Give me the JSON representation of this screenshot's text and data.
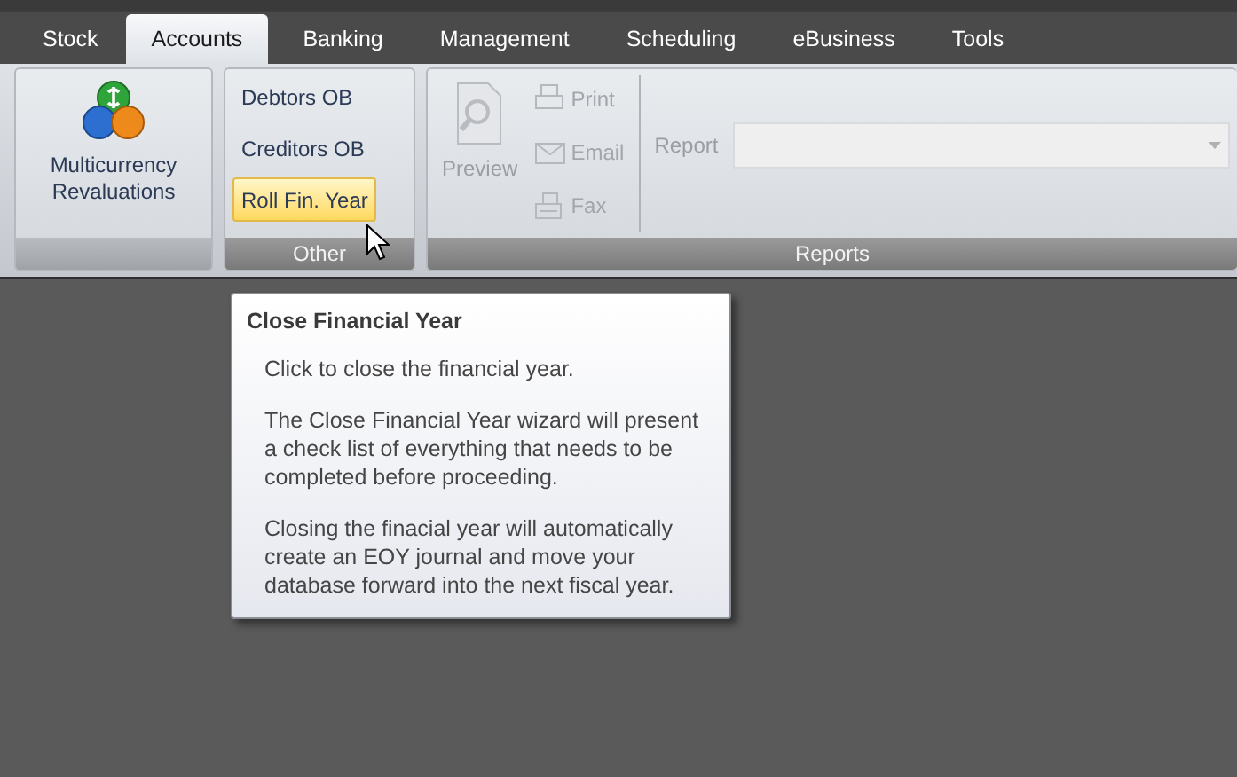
{
  "tabs": [
    {
      "label": "Stock",
      "selected": false
    },
    {
      "label": "Accounts",
      "selected": true
    },
    {
      "label": "Banking",
      "selected": false
    },
    {
      "label": "Management",
      "selected": false
    },
    {
      "label": "Scheduling",
      "selected": false
    },
    {
      "label": "eBusiness",
      "selected": false
    },
    {
      "label": "Tools",
      "selected": false
    }
  ],
  "ribbon": {
    "groups": [
      {
        "kind": "large",
        "buttons": [
          {
            "label": "Multicurrency Revaluations",
            "disabled": false
          }
        ]
      },
      {
        "kind": "list",
        "label": "Other",
        "buttons": [
          {
            "label": "Debtors OB",
            "highlighted": false
          },
          {
            "label": "Creditors OB",
            "highlighted": false
          },
          {
            "label": "Roll Fin. Year",
            "highlighted": true
          }
        ]
      },
      {
        "kind": "reports",
        "label": "Reports",
        "preview": {
          "label": "Preview",
          "disabled": true
        },
        "actions": [
          {
            "kind": "print",
            "label": "Print",
            "disabled": true
          },
          {
            "kind": "email",
            "label": "Email",
            "disabled": true
          },
          {
            "kind": "fax",
            "label": "Fax",
            "disabled": true
          }
        ],
        "report_field": {
          "label": "Report",
          "disabled": true
        }
      }
    ]
  },
  "tooltip": {
    "title": "Close Financial Year",
    "paragraphs": [
      "Click to close the financial year.",
      "The Close Financial Year wizard will present a check list of everything that needs to be completed before proceeding.",
      "Closing the finacial year will automatically create an EOY journal and move your database forward into the next fiscal year."
    ]
  }
}
